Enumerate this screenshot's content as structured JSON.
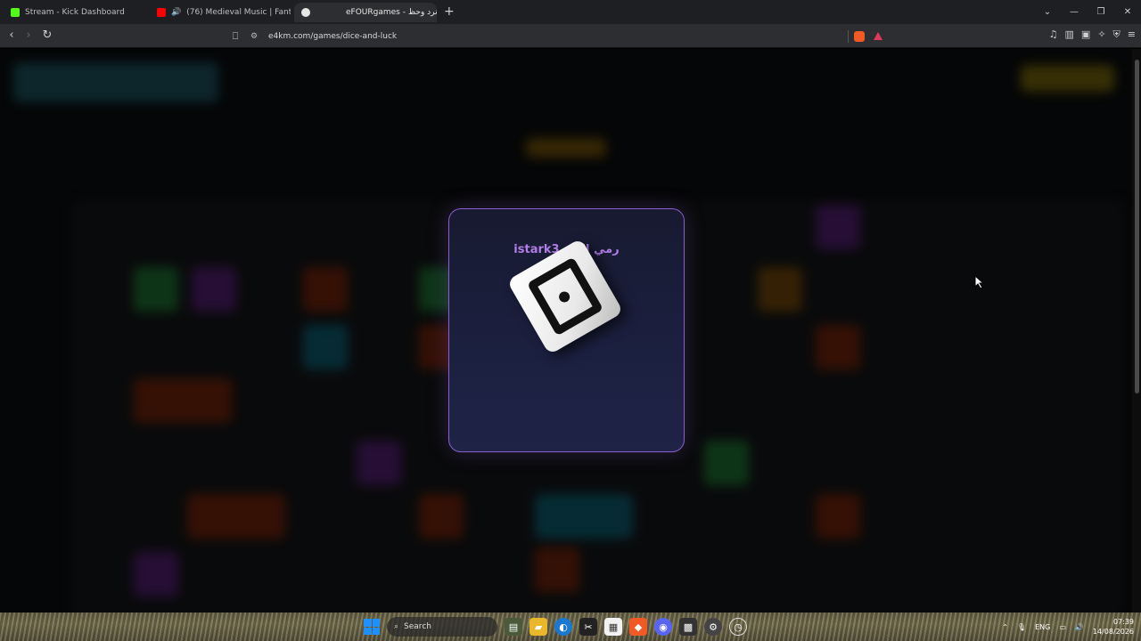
{
  "browser": {
    "tabs": [
      {
        "title": "Stream - Kick Dashboard",
        "favicon_color": "#53fc18",
        "active": false
      },
      {
        "title": "(76) Medieval Music | Fantasy Pla",
        "favicon_color": "#ff0000",
        "active": false
      },
      {
        "title": "eFOURgames - نرد وحظ",
        "favicon_color": "#e6e6e6",
        "active": true
      }
    ],
    "new_tab": "+",
    "url": "e4km.com/games/dice-and-luck",
    "window_controls": [
      "⌄",
      "—",
      "❐",
      "✕"
    ]
  },
  "modal": {
    "title": "istark3 رمي النرد",
    "accent_color": "#b07ee6"
  },
  "taskbar": {
    "search_placeholder": "Search",
    "language": "ENG",
    "time": "07:39",
    "date": "14/08/2026"
  }
}
